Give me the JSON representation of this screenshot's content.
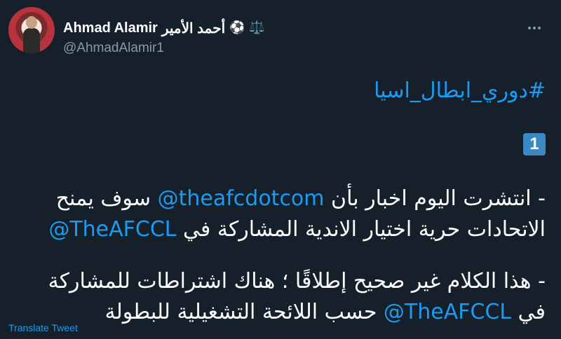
{
  "author": {
    "display_name": "Ahmad Alamir",
    "display_name_ar": "أحمد الأمير",
    "emoji_ball": "⚽",
    "emoji_scales": "⚖️",
    "handle": "@AhmadAlamir1",
    "avatar_icon": "profile-photo"
  },
  "tweet": {
    "hashtag": "#دوري_ابطال_اسيا",
    "number_badge": "1",
    "p1": {
      "line1_a": "- انتشرت اليوم اخبار بأن ",
      "line1_mention": "@theafcdotcom",
      "line1_b": " سوف يمنح",
      "line2_a": "الاتحادات حرية اختيار الاندية المشاركة في ",
      "line2_mention": "@TheAFCCL"
    },
    "p2": {
      "line1": "- هذا الكلام غير صحيح إطلاقًا ؛ هناك اشتراطات للمشاركة",
      "line2_a": "في ",
      "line2_mention": "@TheAFCCL",
      "line2_b": " حسب اللائحة التشغيلية للبطولة"
    }
  },
  "actions": {
    "translate_label": "Translate Tweet",
    "more_icon": "more-options-icon"
  },
  "colors": {
    "background": "#15202b",
    "link": "#1d9bf0",
    "secondary_text": "#8899a6",
    "badge": "#3b88c3"
  }
}
